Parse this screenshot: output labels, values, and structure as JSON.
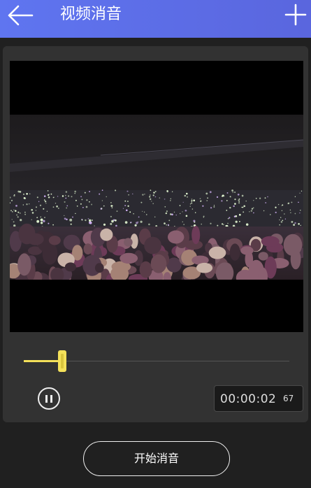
{
  "header": {
    "title": "视频消音",
    "back_icon": "arrow-left-icon",
    "add_icon": "plus-icon",
    "bar_color": "#5a6ce6"
  },
  "player": {
    "scene": "concert crowd with phone lights",
    "progress": 0.145,
    "time_main": "00:00:02",
    "time_ms": "67",
    "accent_color": "#f4e15a",
    "pause_icon": "pause-icon"
  },
  "actions": {
    "start_label": "开始消音"
  }
}
